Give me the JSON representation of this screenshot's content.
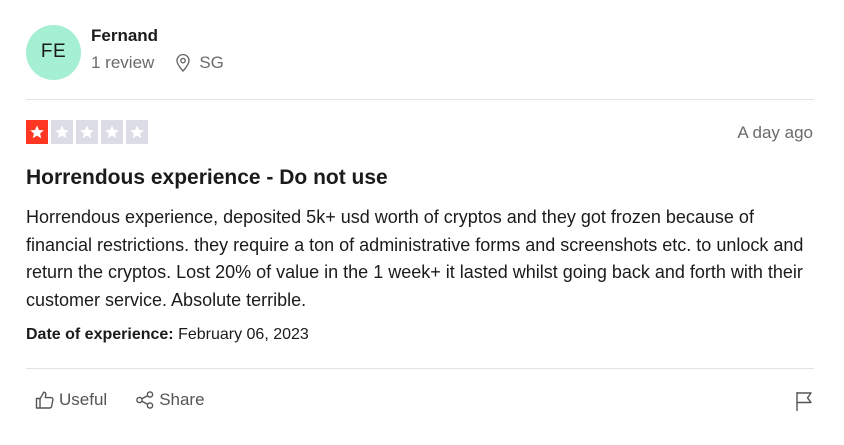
{
  "reviewer": {
    "initials": "FE",
    "name": "Fernand",
    "review_count": "1 review",
    "location": "SG",
    "location_icon": "map-pin-icon"
  },
  "rating": {
    "stars_filled": 1,
    "stars_total": 5,
    "filled_color": "#ff3722",
    "empty_color": "#dcdce6"
  },
  "review": {
    "posted": "A day ago",
    "title": "Horrendous experience - Do not use",
    "body": "Horrendous experience, deposited 5k+ usd worth of cryptos and they got frozen because of financial restrictions. they require a ton of administrative forms and screenshots etc. to unlock and return the cryptos. Lost 20% of value in the 1 week+ it lasted whilst going back and forth with their customer service. Absolute terrible.",
    "experience_label": "Date of experience:",
    "experience_date": "February 06, 2023"
  },
  "actions": {
    "useful_label": "Useful",
    "useful_icon": "thumbs-up-icon",
    "share_label": "Share",
    "share_icon": "share-icon",
    "flag_icon": "flag-icon"
  },
  "colors": {
    "avatar_bg": "#a5efd3"
  }
}
